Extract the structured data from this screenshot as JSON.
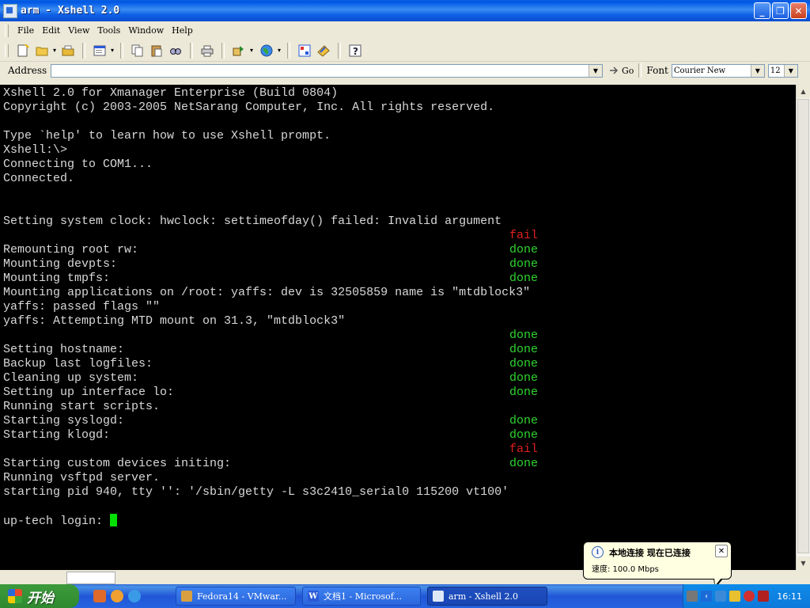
{
  "window": {
    "title": "arm - Xshell 2.0",
    "controls": {
      "minimize": "_",
      "maximize": "❐",
      "close": "✕"
    }
  },
  "menu": [
    {
      "label": "File"
    },
    {
      "label": "Edit"
    },
    {
      "label": "View"
    },
    {
      "label": "Tools"
    },
    {
      "label": "Window"
    },
    {
      "label": "Help"
    }
  ],
  "toolbar": {
    "icons": [
      "new-session-icon",
      "open-folder-icon",
      "folder-icon",
      "properties-icon",
      "copy-icon",
      "paste-icon",
      "find-icon",
      "print-icon",
      "transfer-icon",
      "globe-icon",
      "connect-icon",
      "compose-icon",
      "help-icon"
    ]
  },
  "address_bar": {
    "label": "Address",
    "value": "",
    "go_label": "Go",
    "font_label": "Font",
    "font_value": "Courier New",
    "size_value": "12"
  },
  "terminal": {
    "lines": [
      {
        "text": "Xshell 2.0 for Xmanager Enterprise (Build 0804)",
        "status": ""
      },
      {
        "text": "Copyright (c) 2003-2005 NetSarang Computer, Inc. All rights reserved.",
        "status": ""
      },
      {
        "text": "",
        "status": ""
      },
      {
        "text": "Type `help' to learn how to use Xshell prompt.",
        "status": ""
      },
      {
        "text": "Xshell:\\>",
        "status": ""
      },
      {
        "text": "Connecting to COM1...",
        "status": ""
      },
      {
        "text": "Connected.",
        "status": ""
      },
      {
        "text": "",
        "status": ""
      },
      {
        "text": "",
        "status": ""
      },
      {
        "text": "Setting system clock: hwclock: settimeofday() failed: Invalid argument",
        "status": ""
      },
      {
        "text": "",
        "status": "fail"
      },
      {
        "text": "Remounting root rw:",
        "status": "done"
      },
      {
        "text": "Mounting devpts:",
        "status": "done"
      },
      {
        "text": "Mounting tmpfs:",
        "status": "done"
      },
      {
        "text": "Mounting applications on /root: yaffs: dev is 32505859 name is \"mtdblock3\"",
        "status": ""
      },
      {
        "text": "yaffs: passed flags \"\"",
        "status": ""
      },
      {
        "text": "yaffs: Attempting MTD mount on 31.3, \"mtdblock3\"",
        "status": ""
      },
      {
        "text": "",
        "status": "done"
      },
      {
        "text": "Setting hostname:",
        "status": "done"
      },
      {
        "text": "Backup last logfiles:",
        "status": "done"
      },
      {
        "text": "Cleaning up system:",
        "status": "done"
      },
      {
        "text": "Setting up interface lo:",
        "status": "done"
      },
      {
        "text": "Running start scripts.",
        "status": ""
      },
      {
        "text": "Starting syslogd:",
        "status": "done"
      },
      {
        "text": "Starting klogd:",
        "status": "done"
      },
      {
        "text": "",
        "status": "fail"
      },
      {
        "text": "Starting custom devices initing:",
        "status": "done"
      },
      {
        "text": "Running vsftpd server.",
        "status": ""
      },
      {
        "text": "starting pid 940, tty '': '/sbin/getty -L s3c2410_serial0 115200 vt100'",
        "status": ""
      },
      {
        "text": "",
        "status": ""
      },
      {
        "text": "up-tech login: ",
        "status": "",
        "cursor": true
      }
    ]
  },
  "balloon": {
    "title": "本地连接 现在已连接",
    "text": "速度: 100.0 Mbps",
    "close": "✕"
  },
  "taskbar": {
    "start_label": "开始",
    "tasks": [
      {
        "label": "Fedora14 - VMwar...",
        "active": false
      },
      {
        "label": "文档1 - Microsof...",
        "active": false
      },
      {
        "label": "arm - Xshell 2.0",
        "active": true
      }
    ],
    "clock": "16:11"
  },
  "colors": {
    "terminal_bg": "#000000",
    "terminal_fg": "#d8d8d8",
    "done": "#2fd32f",
    "fail": "#e02020",
    "cursor": "#00e000"
  }
}
